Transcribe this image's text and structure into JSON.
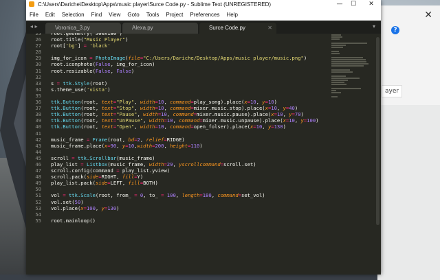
{
  "window": {
    "title": "C:\\Users\\Dariche\\Desktop\\Apps\\music player\\Surce Code.py - Sublime Text (UNREGISTERED)",
    "minimize": "—",
    "maximize": "☐",
    "close": "✕"
  },
  "menu": [
    "File",
    "Edit",
    "Selection",
    "Find",
    "View",
    "Goto",
    "Tools",
    "Project",
    "Preferences",
    "Help"
  ],
  "tabs": [
    {
      "label": "Voronica_3.py",
      "active": false
    },
    {
      "label": "Alexa.py",
      "active": false
    },
    {
      "label": "Surce Code.py",
      "active": true
    }
  ],
  "tab_nav": "◂ ▸",
  "tab_close": "✕",
  "tab_dropdown": "▾",
  "background_window": {
    "close": "✕",
    "help_icon": "?",
    "text_fragment": "ayer"
  },
  "line_numbers": [
    "",
    "25",
    "26",
    "27",
    "28",
    "29",
    "30",
    "31",
    "32",
    "33",
    "34",
    "35",
    "36",
    "37",
    "38",
    "39",
    "40",
    "41",
    "42",
    "43",
    "44",
    "45",
    "46",
    "47",
    "48",
    "49",
    "50",
    "51",
    "52",
    "53",
    "54",
    "55"
  ],
  "code_lines": [
    "root.geometry( 500x180 )",
    "root.title(\"Music Player\")",
    "root['bg'] = 'black'",
    "",
    "img_for_icon = PhotoImage(file=\"C:/Users/Dariche/Desktop/Apps/music player/music.png\")",
    "root.iconphoto(False, img_for_icon)",
    "root.resizable(False, False)",
    "",
    "s = ttk.Style(root)",
    "s.theme_use('vista')",
    "",
    "ttk.Button(root, text=\"Play\", width=10, command=play_song).place(x=10, y=10)",
    "ttk.Button(root, text=\"Stop\", width=10, command=mixer.music.stop).place(x=10, y=40)",
    "ttk.Button(root, text=\"Pause\", width=10, command=mixer.music.pause).place(x=10, y=70)",
    "ttk.Button(root, text=\"UnPause\", width=10, command=mixer.music.unpause).place(x=10, y=100)",
    "ttk.Button(root, text=\"Open\", width=10, command=open_folser).place(x=10, y=130)",
    "",
    "music_frame = Frame(root, bd=2, relief=RIDGE)",
    "music_frame.place(x=90, y=10,width=200, height=110)",
    "",
    "scroll = ttk.Scrollbar(music_frame)",
    "play_list = Listbox(music_frame, width=29, yscrollcommand=scroll.set)",
    "scroll.config(command = play_list.yview)",
    "scroll.pack(side=RIGHT, fill=Y)",
    "play_list.pack(side=LEFT, fill=BOTH)",
    "",
    "vol = ttk.Scale(root, from_ = 0, to_ = 100, length=180, command=set_vol)",
    "vol.set(50)",
    "vol.place(x=100, y=130)",
    "",
    "root.mainloop()"
  ],
  "colors": {
    "editor_bg": "#272822",
    "string": "#e6db74",
    "keyword": "#f92672",
    "number": "#ae81ff",
    "function": "#66d9ef",
    "argument": "#fd971f"
  }
}
